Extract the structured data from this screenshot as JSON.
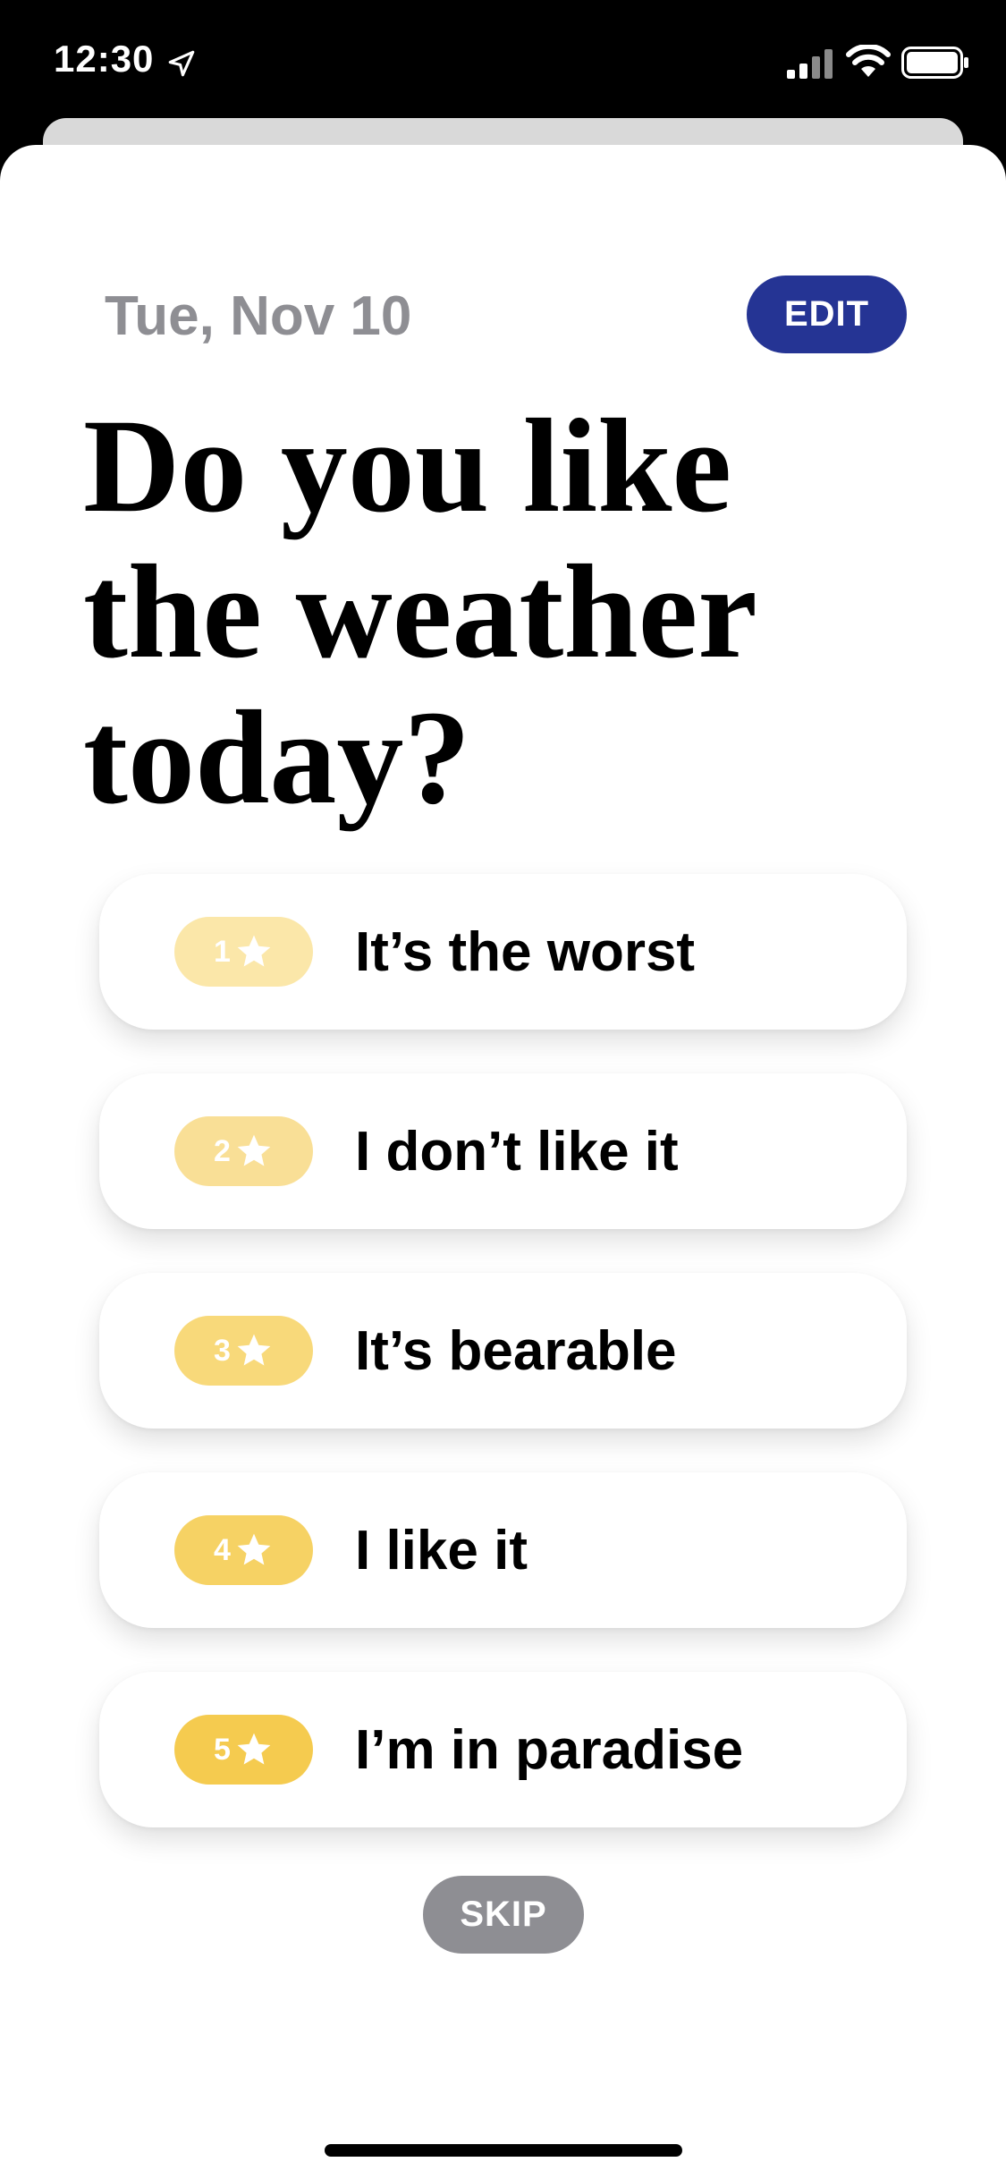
{
  "status_bar": {
    "time": "12:30",
    "icons": [
      "location-arrow-icon",
      "cellular-signal-icon",
      "wifi-icon",
      "battery-icon"
    ]
  },
  "header": {
    "date": "Tue, Nov 10",
    "edit_label": "EDIT"
  },
  "question": {
    "text": "Do you like the weather today?"
  },
  "options": [
    {
      "rating": "1",
      "label": "It’s the worst",
      "color": "#fbe7a9"
    },
    {
      "rating": "2",
      "label": "I don’t like it",
      "color": "#f9df96"
    },
    {
      "rating": "3",
      "label": "It’s bearable",
      "color": "#f8d97a"
    },
    {
      "rating": "4",
      "label": "I like it",
      "color": "#f6d264"
    },
    {
      "rating": "5",
      "label": "I’m in paradise",
      "color": "#f5cb4f"
    }
  ],
  "skip_label": "SKIP",
  "colors": {
    "edit_button": "#253494",
    "skip_button": "#8e8e93",
    "date_text": "#8e8e93"
  }
}
